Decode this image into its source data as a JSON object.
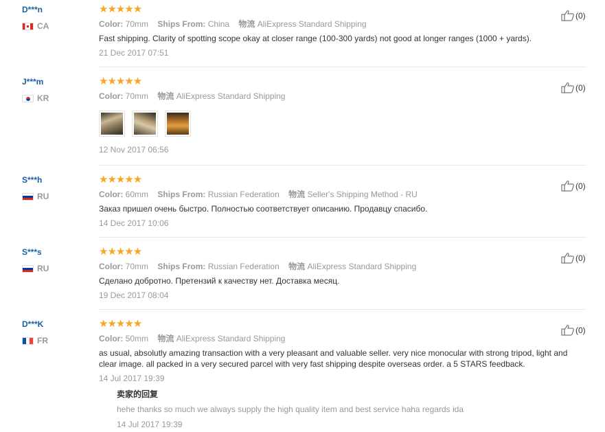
{
  "reviews": [
    {
      "user": "D***n",
      "country": "CA",
      "stars": "★★★★★",
      "color_label": "Color:",
      "color": "70mm",
      "ships_label": "Ships From:",
      "ships": "China",
      "logistics_label": "物流",
      "logistics": "AliExpress Standard Shipping",
      "text": "Fast shipping. Clarity of spotting scope okay at closer range (100-300 yards) not good at longer ranges (1000 + yards).",
      "date": "21 Dec 2017 07:51",
      "likes": "(0)"
    },
    {
      "user": "J***m",
      "country": "KR",
      "stars": "★★★★★",
      "color_label": "Color:",
      "color": "70mm",
      "logistics_label": "物流",
      "logistics": "AliExpress Standard Shipping",
      "date": "12 Nov 2017 06:56",
      "likes": "(0)"
    },
    {
      "user": "S***h",
      "country": "RU",
      "stars": "★★★★★",
      "color_label": "Color:",
      "color": "60mm",
      "ships_label": "Ships From:",
      "ships": "Russian Federation",
      "logistics_label": "物流",
      "logistics": "Seller's Shipping Method - RU",
      "text": "Заказ пришел очень быстро. Полностью соответствует описанию. Продавцу спасибо.",
      "date": "14 Dec 2017 10:06",
      "likes": "(0)"
    },
    {
      "user": "S***s",
      "country": "RU",
      "stars": "★★★★★",
      "color_label": "Color:",
      "color": "70mm",
      "ships_label": "Ships From:",
      "ships": "Russian Federation",
      "logistics_label": "物流",
      "logistics": "AliExpress Standard Shipping",
      "text": "Сделано добротно. Претензий к качеству нет. Доставка месяц.",
      "date": "19 Dec 2017 08:04",
      "likes": "(0)"
    },
    {
      "user": "D***K",
      "country": "FR",
      "stars": "★★★★★",
      "color_label": "Color:",
      "color": "50mm",
      "logistics_label": "物流",
      "logistics": "AliExpress Standard Shipping",
      "text": "as usual, absolutly amazing transaction with a very pleasant and valuable seller. very nice monocular with strong tripod, light and clear image. all packed in a very secured parcel with very fast shipping despite overseas order. a 5 STARS feedback.",
      "date": "14 Jul 2017 19:39",
      "likes": "(0)",
      "reply_title": "卖家的回复",
      "reply_text": "hehe thanks so much we always supply the high quality item and best service haha regards ida",
      "reply_date": "14 Jul 2017 19:39"
    }
  ],
  "colors": {
    "username": "#1a5fa3",
    "star": "#f5a623",
    "muted": "#999999"
  }
}
